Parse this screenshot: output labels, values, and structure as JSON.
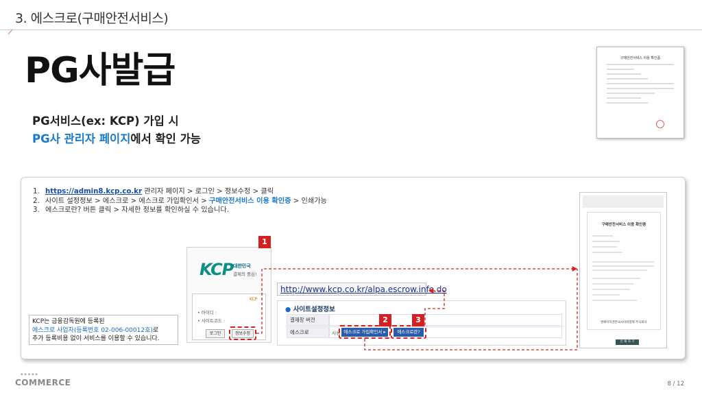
{
  "header": {
    "section_title": "3. 에스크로(구매안전서비스)"
  },
  "main": {
    "title": "PG사발급",
    "desc_line1": "PG서비스(ex: KCP) 가입 시",
    "desc_line2_highlight": "PG사 관리자 페이지",
    "desc_line2_rest": "에서 확인 가능"
  },
  "thumbnail_doc": {
    "title": "구매안전서비스 이용 확인증"
  },
  "steps": [
    {
      "num": "1.",
      "link": "https://admin8.kcp.co.kr",
      "text": " 관리자 페이지 > 로그인 > 정보수정 > 클릭"
    },
    {
      "num": "2.",
      "pre": "사이트 설정정보 > 에스크로 > 에스크로 가입확인서 > ",
      "highlight": "구매안전서비스 이용 확인증",
      "post": " > 인쇄가능"
    },
    {
      "num": "3.",
      "text": "에스크로란? 버튼 클릭 > 자세한 정보를 확인하실 수 있습니다."
    }
  ],
  "kcp_login": {
    "logo": "KCP",
    "tagline1": "대한민국",
    "tagline2": "결제의 중심!",
    "mini_logo": "KCP",
    "id_label": "• 아이디 :",
    "site_code_label": "• 사이트코드 :",
    "login_button": "로그인",
    "info_button": "정보수정",
    "badge": "1"
  },
  "escrow_url": "http://www.kcp.co.kr/alpa.escrow.info.do",
  "site_settings": {
    "heading": "사이트설정정보",
    "row1_label": "결제창 버전",
    "row2_label": "에스크로",
    "row2_prefix": "사용",
    "btn_confirm": "에스크로 가입확인서 ▸",
    "btn_what": "에스크로란?",
    "badge2": "2",
    "badge3": "3"
  },
  "info_box": {
    "line1": "KCP는 금융감독원에 등록된",
    "line2_highlight": "에스크로 사업자(등록번호 02-006-00012호)",
    "line2_rest": "로",
    "line3": "추가 등록비용 없이 서비스를 이용할 수 있습니다."
  },
  "big_doc": {
    "title": "구매안전서비스 이용 확인증",
    "footer": "엔에이치엔한국사이버결제 주식회사",
    "print_button": "인 쇄 하 기"
  },
  "footer": {
    "logo": "COMMERCE",
    "page": "8 / 12"
  },
  "colors": {
    "accent_blue": "#1a7ac8",
    "badge_red": "#d32020",
    "kcp_green": "#0a8e86",
    "link_blue": "#1a4ea8"
  }
}
